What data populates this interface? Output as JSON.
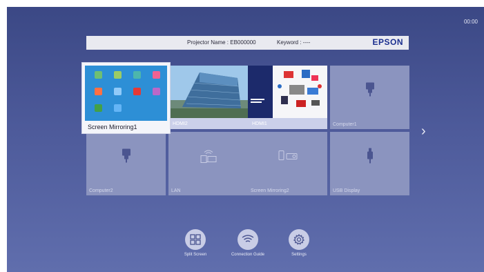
{
  "clock": "00:00",
  "header": {
    "projector_name_label": "Projector Name : EB000000",
    "keyword_label": "Keyword : ----",
    "brand": "EPSON"
  },
  "sources": [
    {
      "label": "Screen Mirroring1",
      "selected": true
    },
    {
      "label": "HDMI2"
    },
    {
      "label": "HDMI1"
    },
    {
      "label": "Computer1"
    },
    {
      "label": "Computer2"
    },
    {
      "label": "LAN"
    },
    {
      "label": "Screen Mirroring2"
    },
    {
      "label": "USB Display"
    }
  ],
  "bottom_buttons": [
    {
      "label": "Split Screen",
      "icon": "split-screen-icon"
    },
    {
      "label": "Connection Guide",
      "icon": "wifi-icon"
    },
    {
      "label": "Settings",
      "icon": "gear-icon"
    }
  ],
  "colors": {
    "background": "#4d5a9a",
    "brand": "#1b2f8f",
    "tile": "#8b94bf"
  }
}
